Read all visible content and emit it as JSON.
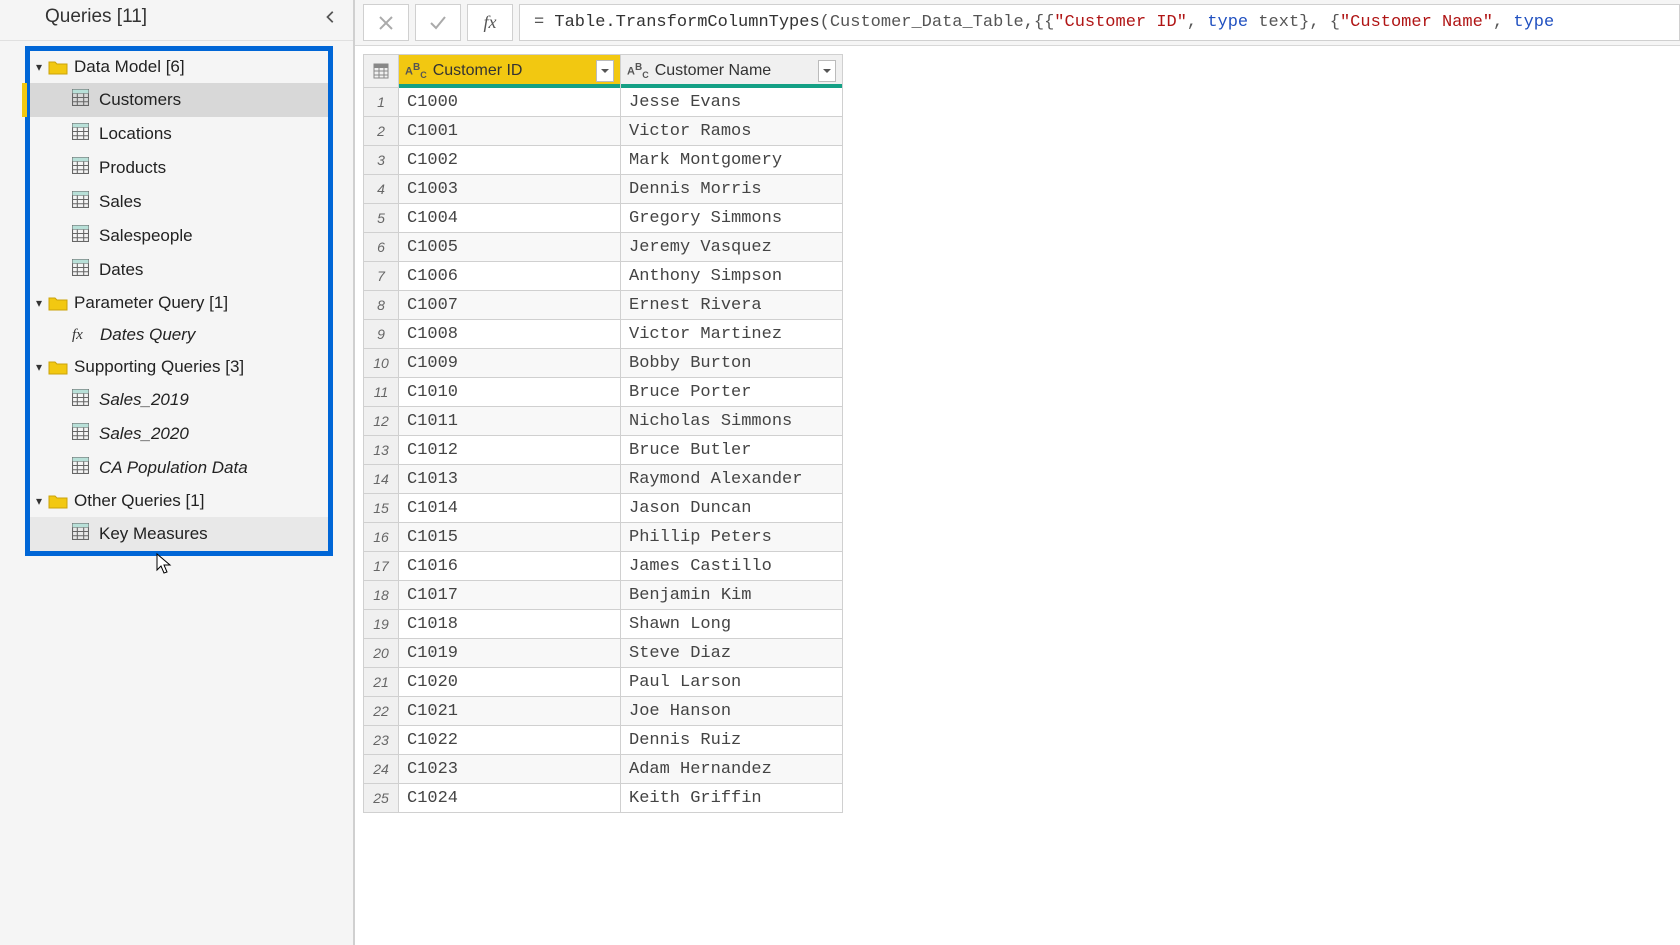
{
  "sidebar": {
    "title": "Queries [11]",
    "folders": [
      {
        "label": "Data Model [6]",
        "items": [
          {
            "label": "Customers",
            "kind": "table",
            "active": true
          },
          {
            "label": "Locations",
            "kind": "table"
          },
          {
            "label": "Products",
            "kind": "table"
          },
          {
            "label": "Sales",
            "kind": "table"
          },
          {
            "label": "Salespeople",
            "kind": "table"
          },
          {
            "label": "Dates",
            "kind": "table"
          }
        ]
      },
      {
        "label": "Parameter Query [1]",
        "items": [
          {
            "label": "Dates Query",
            "kind": "fx",
            "italic": true
          }
        ]
      },
      {
        "label": "Supporting Queries [3]",
        "items": [
          {
            "label": "Sales_2019",
            "kind": "table",
            "italic": true
          },
          {
            "label": "Sales_2020",
            "kind": "table",
            "italic": true
          },
          {
            "label": "CA Population Data",
            "kind": "table",
            "italic": true
          }
        ]
      },
      {
        "label": "Other Queries [1]",
        "items": [
          {
            "label": "Key Measures",
            "kind": "table",
            "hover": true
          }
        ]
      }
    ]
  },
  "formula": {
    "prefix": "= ",
    "fn": "Table.TransformColumnTypes",
    "open": "(Customer_Data_Table,{{",
    "str1": "\"Customer ID\"",
    "mid1": ", ",
    "kw1": "type",
    "mid2": " text}, {",
    "str2": "\"Customer Name\"",
    "mid3": ", ",
    "kw2": "type"
  },
  "table": {
    "columns": [
      "Customer ID",
      "Customer Name"
    ],
    "rows": [
      {
        "n": "1",
        "id": "C1000",
        "name": "Jesse Evans"
      },
      {
        "n": "2",
        "id": "C1001",
        "name": "Victor Ramos"
      },
      {
        "n": "3",
        "id": "C1002",
        "name": "Mark Montgomery"
      },
      {
        "n": "4",
        "id": "C1003",
        "name": "Dennis Morris"
      },
      {
        "n": "5",
        "id": "C1004",
        "name": "Gregory Simmons"
      },
      {
        "n": "6",
        "id": "C1005",
        "name": "Jeremy Vasquez"
      },
      {
        "n": "7",
        "id": "C1006",
        "name": "Anthony Simpson"
      },
      {
        "n": "8",
        "id": "C1007",
        "name": "Ernest Rivera"
      },
      {
        "n": "9",
        "id": "C1008",
        "name": "Victor Martinez"
      },
      {
        "n": "10",
        "id": "C1009",
        "name": "Bobby Burton"
      },
      {
        "n": "11",
        "id": "C1010",
        "name": "Bruce Porter"
      },
      {
        "n": "12",
        "id": "C1011",
        "name": "Nicholas Simmons"
      },
      {
        "n": "13",
        "id": "C1012",
        "name": "Bruce Butler"
      },
      {
        "n": "14",
        "id": "C1013",
        "name": "Raymond Alexander"
      },
      {
        "n": "15",
        "id": "C1014",
        "name": "Jason Duncan"
      },
      {
        "n": "16",
        "id": "C1015",
        "name": "Phillip Peters"
      },
      {
        "n": "17",
        "id": "C1016",
        "name": "James Castillo"
      },
      {
        "n": "18",
        "id": "C1017",
        "name": "Benjamin Kim"
      },
      {
        "n": "19",
        "id": "C1018",
        "name": "Shawn Long"
      },
      {
        "n": "20",
        "id": "C1019",
        "name": "Steve Diaz"
      },
      {
        "n": "21",
        "id": "C1020",
        "name": "Paul Larson"
      },
      {
        "n": "22",
        "id": "C1021",
        "name": "Joe Hanson"
      },
      {
        "n": "23",
        "id": "C1022",
        "name": "Dennis Ruiz"
      },
      {
        "n": "24",
        "id": "C1023",
        "name": "Adam Hernandez"
      },
      {
        "n": "25",
        "id": "C1024",
        "name": "Keith Griffin"
      }
    ]
  }
}
